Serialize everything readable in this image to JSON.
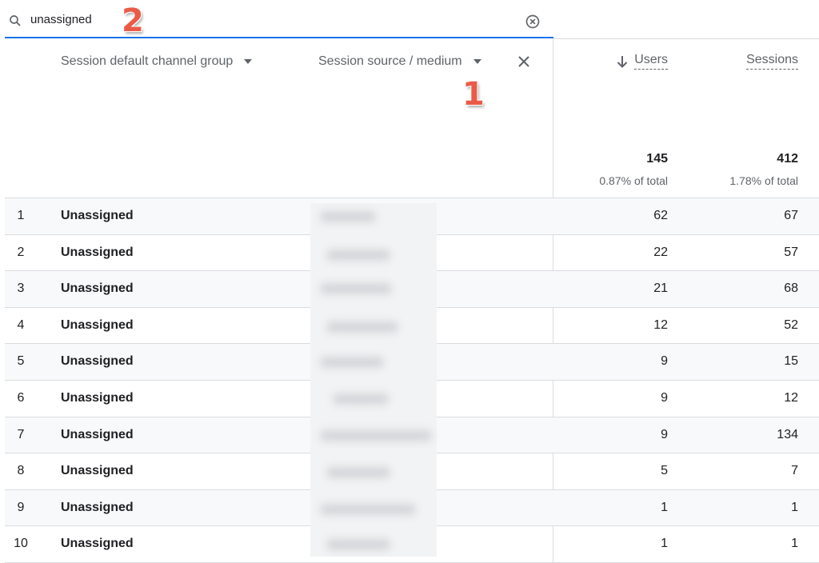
{
  "search": {
    "value": "unassigned",
    "placeholder": ""
  },
  "annotations": {
    "marker_1": "1",
    "marker_2": "2"
  },
  "dimensions": {
    "primary": "Session default channel group",
    "secondary": "Session source / medium"
  },
  "metrics": {
    "users": {
      "label": "Users",
      "total": "145",
      "pct": "0.87% of total"
    },
    "sessions": {
      "label": "Sessions",
      "total": "412",
      "pct": "1.78% of total"
    }
  },
  "rows": [
    {
      "index": "1",
      "channel": "Unassigned",
      "users": "62",
      "sessions": "67"
    },
    {
      "index": "2",
      "channel": "Unassigned",
      "users": "22",
      "sessions": "57"
    },
    {
      "index": "3",
      "channel": "Unassigned",
      "users": "21",
      "sessions": "68"
    },
    {
      "index": "4",
      "channel": "Unassigned",
      "users": "12",
      "sessions": "52"
    },
    {
      "index": "5",
      "channel": "Unassigned",
      "users": "9",
      "sessions": "15"
    },
    {
      "index": "6",
      "channel": "Unassigned",
      "users": "9",
      "sessions": "12"
    },
    {
      "index": "7",
      "channel": "Unassigned",
      "users": "9",
      "sessions": "134"
    },
    {
      "index": "8",
      "channel": "Unassigned",
      "users": "5",
      "sessions": "7"
    },
    {
      "index": "9",
      "channel": "Unassigned",
      "users": "1",
      "sessions": "1"
    },
    {
      "index": "10",
      "channel": "Unassigned",
      "users": "1",
      "sessions": "1"
    }
  ],
  "colors": {
    "accent": "#1a73e8",
    "annotation": "#ea5b47",
    "row_alt": "#f8f9fa",
    "border": "#dadce0"
  },
  "icons": [
    "search-icon",
    "clear-icon",
    "chevron-down-icon",
    "close-icon",
    "arrow-down-icon"
  ]
}
